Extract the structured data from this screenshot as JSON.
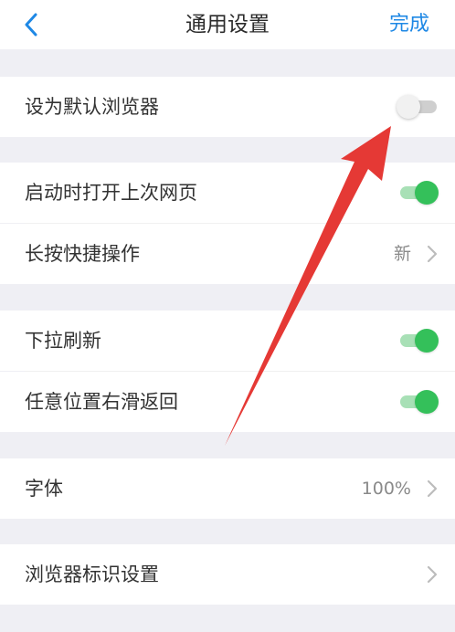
{
  "nav": {
    "title": "通用设置",
    "done_label": "完成"
  },
  "sections": {
    "default_browser": {
      "label": "设为默认浏览器",
      "enabled": false
    },
    "restore_last_page": {
      "label": "启动时打开上次网页",
      "enabled": true
    },
    "long_press": {
      "label": "长按快捷操作",
      "value": "新"
    },
    "pull_refresh": {
      "label": "下拉刷新",
      "enabled": true
    },
    "swipe_back": {
      "label": "任意位置右滑返回",
      "enabled": true
    },
    "font": {
      "label": "字体",
      "value": "100%"
    },
    "browser_id": {
      "label": "浏览器标识设置"
    }
  },
  "colors": {
    "accent": "#1e88e5",
    "toggle_on": "#34c05a",
    "annotation_arrow": "#e53935"
  }
}
